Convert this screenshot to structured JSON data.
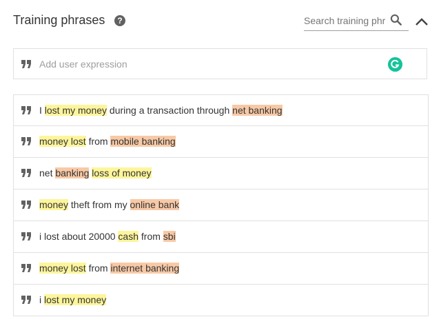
{
  "header": {
    "title": "Training phrases",
    "search_placeholder": "Search training phr"
  },
  "add_expression": {
    "placeholder": "Add user expression"
  },
  "colors": {
    "entity_highlight_1": "#fdf59b",
    "entity_highlight_2": "#f8c9a6",
    "grammarly": "#15c39a"
  },
  "icons": [
    "help-icon",
    "search-icon",
    "chevron-up-icon",
    "quote-icon",
    "grammarly-icon"
  ],
  "phrases": [
    {
      "segments": [
        {
          "text": "I ",
          "hl": ""
        },
        {
          "text": "lost my money",
          "hl": "yellow"
        },
        {
          "text": " during a transaction through ",
          "hl": ""
        },
        {
          "text": "net banking",
          "hl": "orange"
        }
      ]
    },
    {
      "segments": [
        {
          "text": "money lost",
          "hl": "yellow"
        },
        {
          "text": " from ",
          "hl": ""
        },
        {
          "text": "mobile banking",
          "hl": "orange"
        }
      ]
    },
    {
      "segments": [
        {
          "text": "net ",
          "hl": ""
        },
        {
          "text": "banking",
          "hl": "orange"
        },
        {
          "text": " ",
          "hl": ""
        },
        {
          "text": "loss of money",
          "hl": "yellow"
        }
      ]
    },
    {
      "segments": [
        {
          "text": "money",
          "hl": "yellow"
        },
        {
          "text": " theft from my ",
          "hl": ""
        },
        {
          "text": "online bank",
          "hl": "orange"
        }
      ]
    },
    {
      "segments": [
        {
          "text": "i lost about 20000 ",
          "hl": ""
        },
        {
          "text": "cash",
          "hl": "yellow"
        },
        {
          "text": " from ",
          "hl": ""
        },
        {
          "text": "sbi",
          "hl": "orange"
        }
      ]
    },
    {
      "segments": [
        {
          "text": "money lost",
          "hl": "yellow"
        },
        {
          "text": " from ",
          "hl": ""
        },
        {
          "text": "internet banking",
          "hl": "orange"
        }
      ]
    },
    {
      "segments": [
        {
          "text": "i ",
          "hl": ""
        },
        {
          "text": "lost my money",
          "hl": "yellow"
        }
      ]
    }
  ]
}
